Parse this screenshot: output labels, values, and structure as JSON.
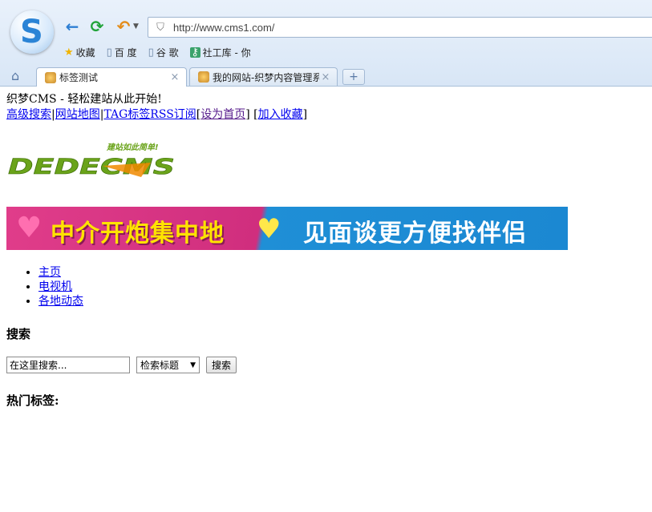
{
  "browser": {
    "logo_letter": "S",
    "url": "http://www.cms1.com/",
    "bookmarks": [
      {
        "label": "收藏",
        "icon": "star-icon"
      },
      {
        "label": "百 度",
        "icon": "page-icon"
      },
      {
        "label": "谷 歌",
        "icon": "page-icon"
      },
      {
        "label": "社工库 - 你",
        "icon": "key-icon"
      }
    ],
    "tabs": [
      {
        "title": "标签测试",
        "active": true
      },
      {
        "title": "我的网站-织梦内容管理系",
        "active": false
      }
    ],
    "close_glyph": "×",
    "newtab_glyph": "+"
  },
  "page": {
    "welcome": "织梦CMS - 轻松建站从此开始!",
    "links": {
      "advanced_search": "高级搜索",
      "sep1": "|",
      "sitemap": "网站地图",
      "sep2": "|",
      "tag_rss": "TAG标签RSS订阅",
      "open1": "[",
      "set_home": "设为首页",
      "close1": "] [",
      "add_fav": "加入收藏",
      "close2": "]"
    },
    "logo": {
      "text": "DEDECMS",
      "slogan": "建站如此简单!"
    },
    "banner": {
      "text_left": "中介开炮集中地",
      "text_right": "见面谈更方便找伴侣"
    },
    "menu": [
      "主页",
      "电视机",
      "各地动态"
    ],
    "search": {
      "heading": "搜索",
      "placeholder": "在这里搜索...",
      "select_value": "检索标题",
      "button": "搜索"
    },
    "hot_tags_heading": "热门标签:"
  },
  "colors": {
    "chrome_bg": "#dde9f7",
    "link": "#0000ee",
    "logo_green": "#6aa31a",
    "logo_orange": "#f08a00"
  }
}
